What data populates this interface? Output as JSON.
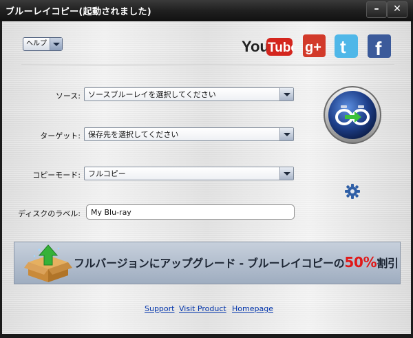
{
  "window": {
    "title": "ブルーレイコピー(起動されました)",
    "minimize_label": "–",
    "close_label": "✕"
  },
  "toolbar": {
    "help_label": "ヘルプ"
  },
  "social": {
    "youtube_you": "You",
    "youtube_tube": "Tube",
    "googleplus": "g+",
    "twitter": "t",
    "facebook": "f"
  },
  "form": {
    "source_label": "ソース:",
    "source_value": "ソースブルーレイを選択してください",
    "target_label": "ターゲット:",
    "target_value": "保存先を選択してください",
    "mode_label": "コピーモード:",
    "mode_value": "フルコピー",
    "disc_label": "ディスクのラベル:",
    "disc_value": "My Blu-ray"
  },
  "banner": {
    "text_before": "フルバージョンにアップグレード - ブルーレイコピーの",
    "percent": "50%",
    "text_after": "割引"
  },
  "footer": {
    "support": "Support",
    "visit": "Visit Product",
    "homepage": "Homepage"
  },
  "colors": {
    "accent_blue": "#1e3f8a",
    "promo_red": "#e01818",
    "link_blue": "#0033aa"
  }
}
